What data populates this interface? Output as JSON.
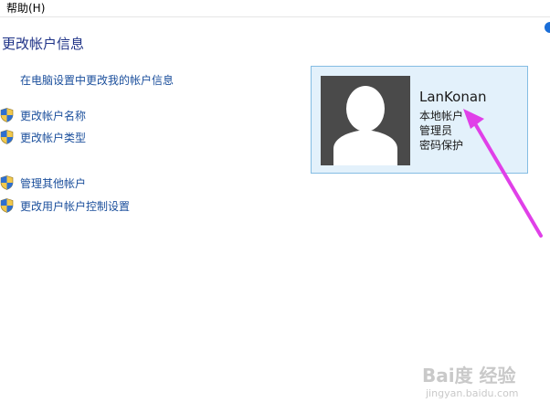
{
  "menu": {
    "help": "帮助(H)"
  },
  "page": {
    "title": "更改帐户信息"
  },
  "links": {
    "pc_settings": "在电脑设置中更改我的帐户信息",
    "change_name": "更改帐户名称",
    "change_type": "更改帐户类型",
    "manage_other": "管理其他帐户",
    "uac_settings": "更改用户帐户控制设置"
  },
  "account": {
    "name": "LanKonan",
    "type": "本地帐户",
    "role": "管理员",
    "protection": "密码保护"
  },
  "watermark": {
    "logo": "Bai度 经验",
    "url": "jingyan.baidu.com"
  },
  "colors": {
    "link": "#1b4f9c",
    "title": "#1e3287",
    "card_bg": "#e3f1fb",
    "card_border": "#84bde3",
    "arrow": "#e040e8"
  },
  "icons": {
    "shield": "uac-shield-icon",
    "avatar": "user-silhouette-icon",
    "arrow": "annotation-arrow"
  }
}
